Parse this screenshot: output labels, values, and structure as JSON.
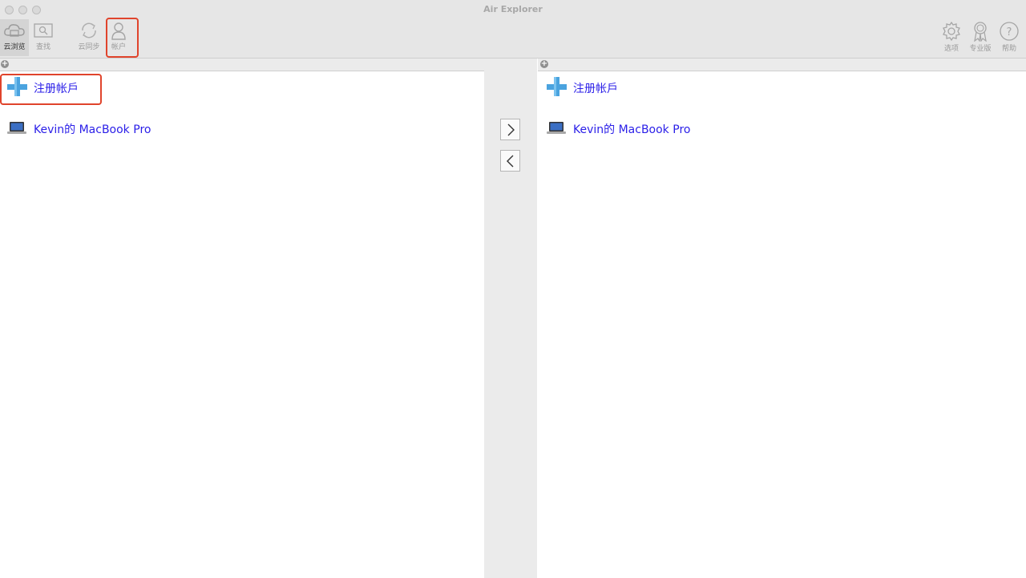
{
  "window": {
    "title": "Air Explorer"
  },
  "toolbar": {
    "left": [
      {
        "label": "云浏览",
        "icon": "cloud-browse-icon"
      },
      {
        "label": "查找",
        "icon": "find-icon"
      },
      {
        "label": "云同步",
        "icon": "cloud-sync-icon"
      },
      {
        "label": "帐户",
        "icon": "account-icon"
      }
    ],
    "right": [
      {
        "label": "选项",
        "icon": "gear-icon"
      },
      {
        "label": "专业版",
        "icon": "award-ribbon-icon"
      },
      {
        "label": "帮助",
        "icon": "help-icon"
      }
    ]
  },
  "left_pane": {
    "items": [
      {
        "label": "注册帐戶",
        "icon": "add-account-icon"
      },
      {
        "label": "Kevin的 MacBook Pro",
        "icon": "laptop-icon"
      }
    ]
  },
  "right_pane": {
    "items": [
      {
        "label": "注册帐戶",
        "icon": "add-account-icon"
      },
      {
        "label": "Kevin的 MacBook Pro",
        "icon": "laptop-icon"
      }
    ]
  },
  "colors": {
    "link": "#2a1ee8",
    "highlight": "#e0442c",
    "plus": "#4aa3df"
  }
}
